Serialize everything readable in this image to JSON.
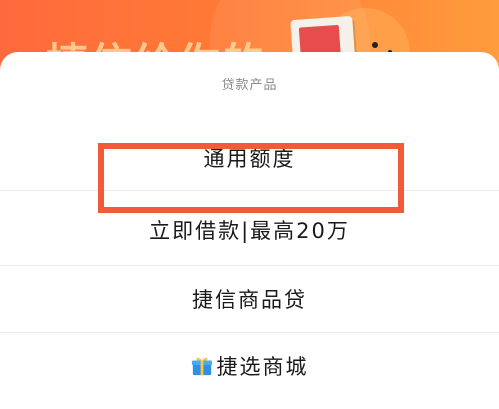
{
  "background": {
    "slogan": "捷信给你的",
    "colors": {
      "banner_start": "#ff6a3d",
      "banner_end": "#ff9c3c"
    }
  },
  "sheet": {
    "title": "贷款产品",
    "items": [
      {
        "label": "通用额度"
      },
      {
        "label": "立即借款|最高20万",
        "highlighted": true
      },
      {
        "label": "捷信商品贷"
      },
      {
        "label": "捷选商城",
        "icon": "gift-icon"
      }
    ]
  },
  "colors": {
    "highlight_border": "#f25a3a",
    "text": "#1a1a1a",
    "title_text": "#8a8a8a"
  }
}
